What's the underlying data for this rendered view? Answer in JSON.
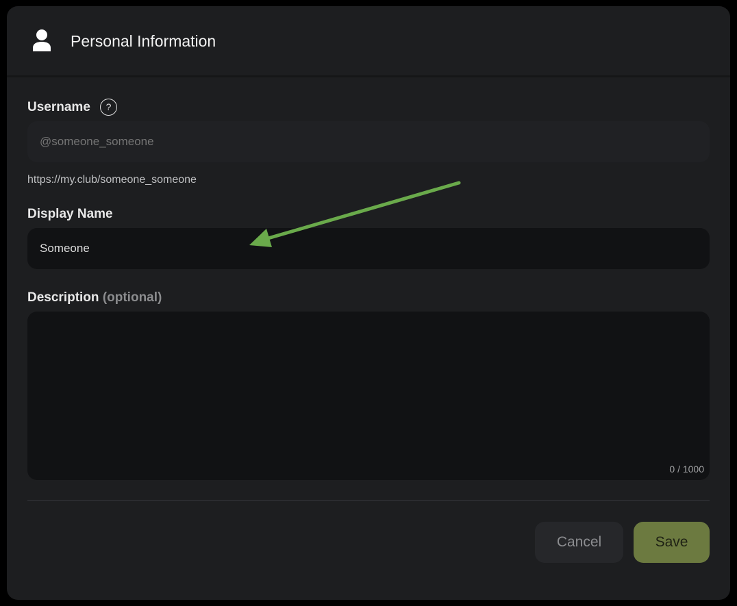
{
  "header": {
    "title": "Personal Information",
    "icon": "user-icon"
  },
  "username": {
    "label": "Username",
    "help_icon": "question-mark-icon",
    "help_glyph": "?",
    "placeholder": "@someone_someone",
    "value": "",
    "url": "https://my.club/someone_someone"
  },
  "display_name": {
    "label": "Display Name",
    "value": "Someone"
  },
  "description": {
    "label": "Description",
    "label_suffix": "(optional)",
    "value": "",
    "char_count": "0 / 1000"
  },
  "actions": {
    "cancel_label": "Cancel",
    "save_label": "Save"
  },
  "colors": {
    "accent": "#6c7a40",
    "annotation_arrow": "#6aaa4b",
    "panel_background": "#1d1e20"
  }
}
